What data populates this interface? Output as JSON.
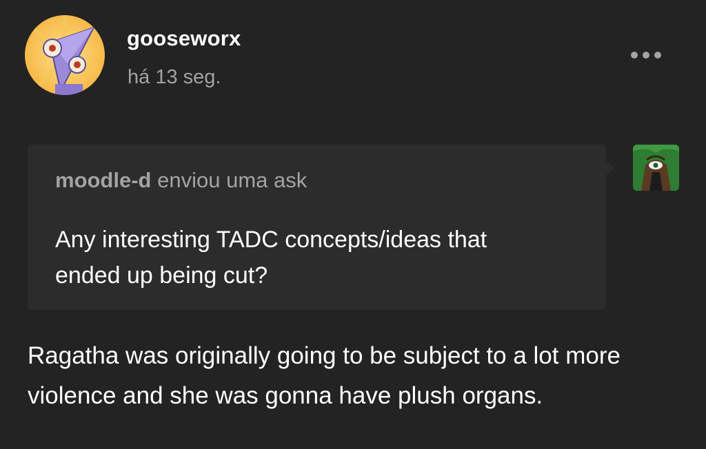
{
  "post": {
    "author": "gooseworx",
    "timestamp": "há 13 seg.",
    "avatar_icon": "purple-triangle-character-avatar",
    "more_icon": "ellipsis-icon"
  },
  "ask": {
    "asker": "moodle-d",
    "action": "enviou uma ask",
    "question": "Any interesting TADC concepts/ideas that ended up being cut?",
    "asker_avatar_icon": "green-character-avatar"
  },
  "answer": {
    "text": "Ragatha was originally going to be subject to a lot more violence and she was gonna have plush organs."
  },
  "colors": {
    "background": "#232323",
    "ask_box": "#2c2c2c",
    "muted_text": "#a3a3a3",
    "text": "#ffffff"
  }
}
